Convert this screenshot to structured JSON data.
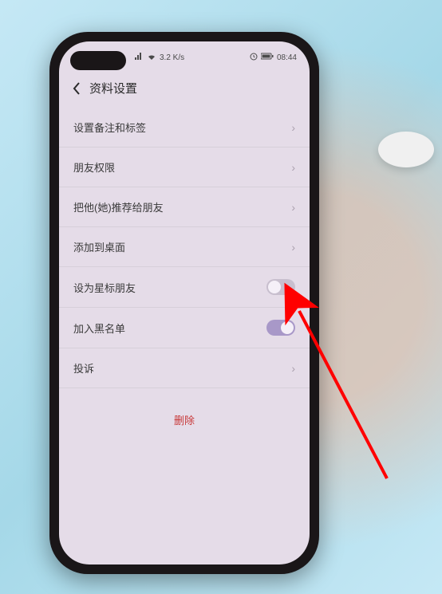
{
  "status_bar": {
    "signal_text": "3.2 K/s",
    "time": "08:44"
  },
  "header": {
    "title": "资料设置"
  },
  "items": [
    {
      "label": "设置备注和标签",
      "type": "nav"
    },
    {
      "label": "朋友权限",
      "type": "nav"
    },
    {
      "label": "把他(她)推荐给朋友",
      "type": "nav"
    },
    {
      "label": "添加到桌面",
      "type": "nav"
    },
    {
      "label": "设为星标朋友",
      "type": "toggle",
      "on": false
    },
    {
      "label": "加入黑名单",
      "type": "toggle",
      "on": true
    },
    {
      "label": "投诉",
      "type": "nav"
    }
  ],
  "delete_button": {
    "label": "删除"
  }
}
